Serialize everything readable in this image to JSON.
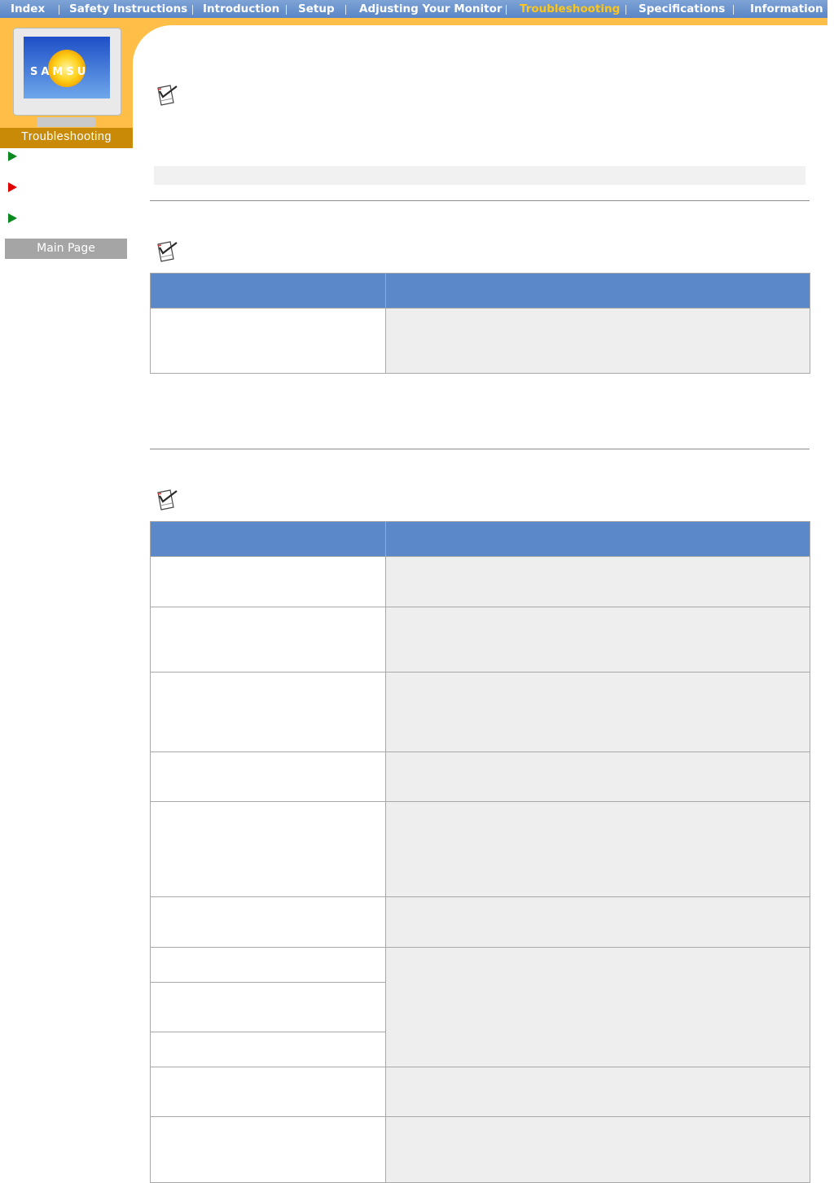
{
  "nav": {
    "items": [
      {
        "label": "Index",
        "active": false
      },
      {
        "label": "Safety Instructions",
        "active": false
      },
      {
        "label": "Introduction",
        "active": false
      },
      {
        "label": "Setup",
        "active": false
      },
      {
        "label": "Adjusting Your Monitor",
        "active": false
      },
      {
        "label": "Troubleshooting",
        "active": true
      },
      {
        "label": "Specifications",
        "active": false
      },
      {
        "label": "Information",
        "active": false
      }
    ]
  },
  "sidebar": {
    "brand_logo_text": "SAMSU",
    "section_title": "Troubleshooting",
    "arrows": [
      {
        "icon": "green-arrow-icon",
        "color": "#0c8a20"
      },
      {
        "icon": "red-arrow-icon",
        "color": "#e00000"
      },
      {
        "icon": "green-arrow-icon",
        "color": "#0c8a20"
      }
    ],
    "main_page_label": "Main Page"
  },
  "colors": {
    "nav_blue": "#5a86c6",
    "active_nav": "#ffc61a",
    "accent_orange": "#ffbe47",
    "section_title_bg": "#c98a07",
    "table_header": "#5b88c9",
    "cell_gray": "#eeeeee"
  },
  "content": {
    "note_icon": "checklist-pencil-icon",
    "table1": {
      "rows": 1
    },
    "table2": {
      "rows": 12
    }
  }
}
